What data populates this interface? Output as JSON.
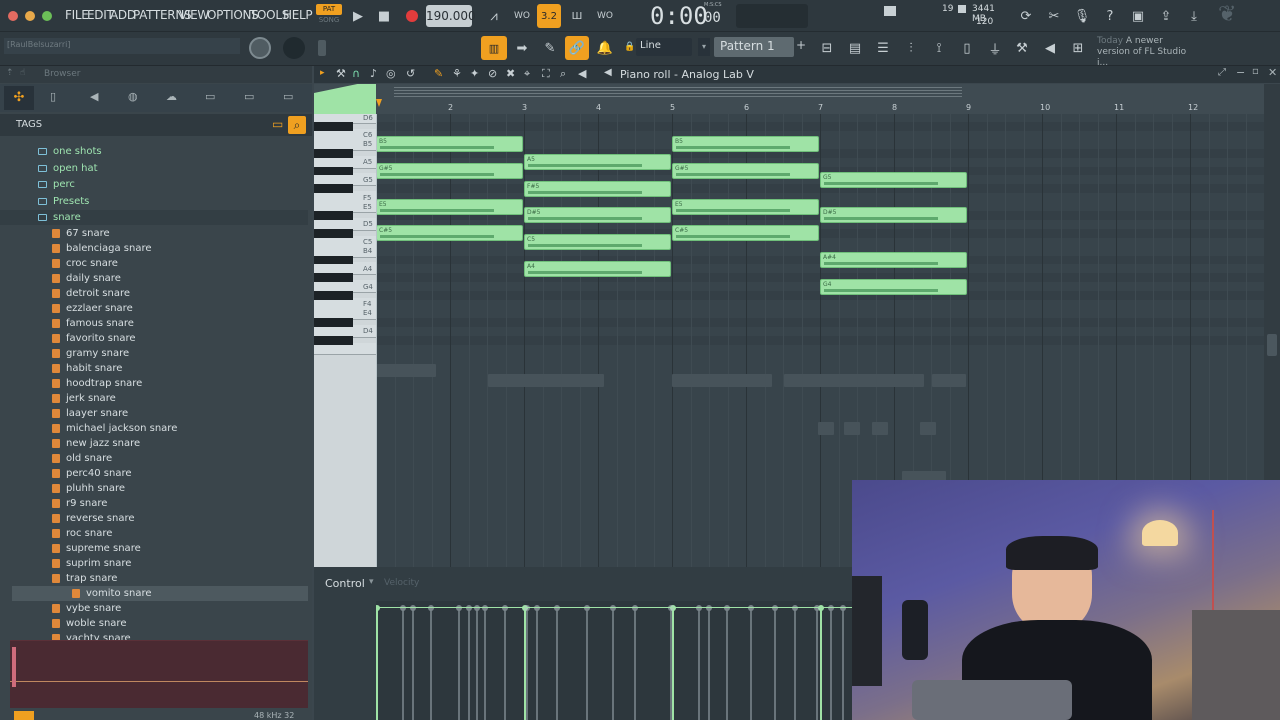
{
  "menu": [
    "FILE",
    "EDIT",
    "ADD",
    "PATTERNS",
    "VIEW",
    "OPTIONS",
    "TOOLS",
    "HELP"
  ],
  "transport": {
    "pat_label": "PAT",
    "song_label": "SONG",
    "tempo": "190.000",
    "time": "0:00",
    "time_sub": "00",
    "time_format": "M:S:CS",
    "snap_value": "3.2"
  },
  "monitor": {
    "cpu": "19",
    "memory": "3441 MB",
    "polyphony": "120"
  },
  "user_field": "[RaulBelsuzarri]",
  "snap_mode": "Line",
  "pattern": "Pattern 1",
  "news": {
    "date": "Today",
    "text": "A newer version of FL Studio i..."
  },
  "browser": {
    "title": "Browser",
    "tags_label": "TAGS",
    "folders": [
      "one shots",
      "open hat",
      "perc",
      "Presets",
      "snare"
    ],
    "files": [
      "67 snare",
      "balenciaga snare",
      "croc snare",
      "daily snare",
      "detroit snare",
      "ezzlaer snare",
      "famous snare",
      "favorito snare",
      "gramy snare",
      "habit snare",
      "hoodtrap snare",
      "jerk snare",
      "laayer snare",
      "michael jackson snare",
      "new jazz snare",
      "old snare",
      "perc40 snare",
      "pluhh snare",
      "r9 snare",
      "reverse snare",
      "roc snare",
      "supreme snare",
      "suprim snare",
      "trap snare",
      "vomito snare",
      "vybe snare",
      "woble snare",
      "yachty snare"
    ],
    "selected": "vomito snare",
    "sample_info": "48 kHz 32"
  },
  "piano_roll": {
    "title": "Piano roll - Analog Lab V",
    "bars": [
      "2",
      "3",
      "4",
      "5",
      "6",
      "7",
      "8",
      "9",
      "10",
      "11",
      "12"
    ],
    "key_labels": [
      "D6",
      "C6",
      "B5",
      "A5",
      "G5",
      "F5",
      "E5",
      "D5",
      "C5",
      "B4",
      "A4",
      "G4",
      "F4",
      "E4",
      "D4"
    ],
    "notes": [
      {
        "pitch": "B5",
        "start": 1,
        "length": 2
      },
      {
        "pitch": "G#5",
        "start": 1,
        "length": 2
      },
      {
        "pitch": "E5",
        "start": 1,
        "length": 2
      },
      {
        "pitch": "C#5",
        "start": 1,
        "length": 2
      },
      {
        "pitch": "A5",
        "start": 3,
        "length": 2
      },
      {
        "pitch": "F#5",
        "start": 3,
        "length": 2
      },
      {
        "pitch": "D#5",
        "start": 3,
        "length": 2
      },
      {
        "pitch": "C5",
        "start": 3,
        "length": 2
      },
      {
        "pitch": "A4",
        "start": 3,
        "length": 2
      },
      {
        "pitch": "B5",
        "start": 5,
        "length": 2
      },
      {
        "pitch": "G#5",
        "start": 5,
        "length": 2
      },
      {
        "pitch": "E5",
        "start": 5,
        "length": 2
      },
      {
        "pitch": "C#5",
        "start": 5,
        "length": 2
      },
      {
        "pitch": "G5",
        "start": 7,
        "length": 2
      },
      {
        "pitch": "D#5",
        "start": 7,
        "length": 2
      },
      {
        "pitch": "A#4",
        "start": 7,
        "length": 2
      },
      {
        "pitch": "G4",
        "start": 7,
        "length": 2
      }
    ],
    "control_label": "Control",
    "control_target": "Velocity"
  },
  "colors": {
    "accent": "#f0a020",
    "note": "#9fe3a6",
    "folder_text": "#9ee4b0",
    "file_icon": "#e0883a"
  }
}
